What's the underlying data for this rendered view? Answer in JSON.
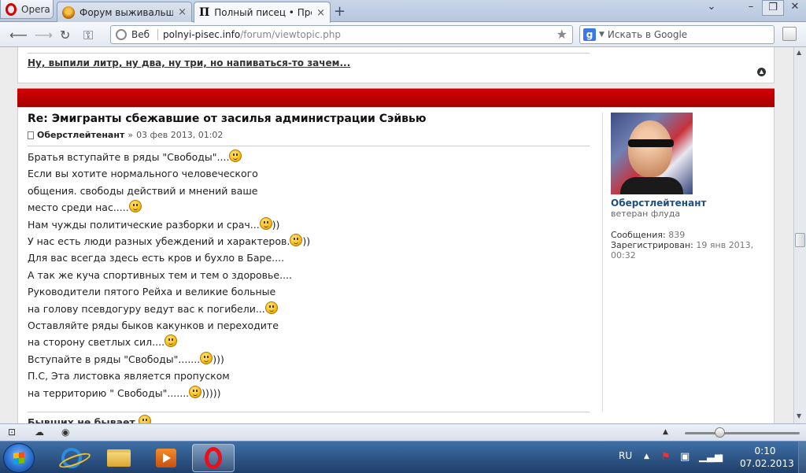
{
  "browser": {
    "menu_label": "Opera",
    "tabs": [
      {
        "title": "Форум выживальщик...",
        "close": "×"
      },
      {
        "title": "Полный писец • Прос...",
        "close": "×"
      }
    ],
    "new_tab": "+",
    "address": {
      "label": "Веб",
      "url_host": "polnyi-pisec.info",
      "url_path": "/forum/viewtopic.php"
    },
    "search": {
      "engine_letter": "g",
      "placeholder": "Искать в Google"
    }
  },
  "page": {
    "previous_post_signature": "Ну, выпили литр, ну два, ну три, но напиваться-то зачем...",
    "post": {
      "title": "Re: Эмигранты сбежавшие от засилья администрации Сэйвью",
      "author": "Оберстлейтенант",
      "date_separator": "»",
      "date": "03 фев 2013, 01:02",
      "lines": [
        {
          "text": "Братья вступайте в ряды \"Свободы\"....",
          "smiley": true,
          "after": ""
        },
        {
          "text": "Если вы хотите нормального человеческого",
          "smiley": false,
          "after": ""
        },
        {
          "text": "общения. свободы действий и мнений ваше",
          "smiley": false,
          "after": ""
        },
        {
          "text": "место среди нас.....",
          "smiley": true,
          "after": ""
        },
        {
          "text": "Нам чужды политические разборки и срач...",
          "smiley": true,
          "after": "))"
        },
        {
          "text": "У нас есть люди разных убеждений и характеров.",
          "smiley": true,
          "after": "))"
        },
        {
          "text": "Для вас всегда здесь есть кров и бухло в Баре....",
          "smiley": false,
          "after": ""
        },
        {
          "text": "А так же куча спортивных тем и тем о здоровье....",
          "smiley": false,
          "after": ""
        },
        {
          "text": "Руководители пятого Рейха и великие больные",
          "smiley": false,
          "after": ""
        },
        {
          "text": "на голову псевдогуру ведут вас к погибели...",
          "smiley": true,
          "after": ""
        },
        {
          "text": "Оставляйте ряды быков какунков и переходите",
          "smiley": false,
          "after": ""
        },
        {
          "text": "на сторону светлых сил....",
          "smiley": true,
          "after": ""
        },
        {
          "text": "Вступайте в ряды \"Свободы\".......",
          "smiley": true,
          "after": ")))"
        },
        {
          "text": "П.С, Эта листовка является пропуском",
          "smiley": false,
          "after": ""
        },
        {
          "text": "на территорию \" Свободы\".......",
          "smiley": true,
          "after": ")))))"
        }
      ],
      "signature": "Бывших не бывает"
    },
    "profile": {
      "name": "Оберстлейтенант",
      "rank": "ветеран флуда",
      "posts_label": "Сообщения:",
      "posts_value": "839",
      "registered_label": "Зарегистрирован:",
      "registered_value": "19 янв 2013, 00:32"
    }
  },
  "taskbar": {
    "language": "RU",
    "time": "0:10",
    "date": "07.02.2013"
  }
}
